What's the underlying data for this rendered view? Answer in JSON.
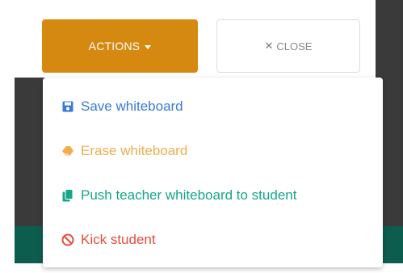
{
  "toolbar": {
    "actions_label": "ACTIONS",
    "close_label": "CLOSE"
  },
  "menu": {
    "items": [
      {
        "label": "Save whiteboard",
        "icon": "save-icon",
        "color": "#3a7bd5"
      },
      {
        "label": "Erase whiteboard",
        "icon": "eraser-icon",
        "color": "#f0ad4e"
      },
      {
        "label": "Push teacher whiteboard to student",
        "icon": "copy-icon",
        "color": "#17a589"
      },
      {
        "label": "Kick student",
        "icon": "ban-icon",
        "color": "#e74c3c"
      }
    ]
  },
  "colors": {
    "actions_button": "#d68910",
    "footer_bar": "#0d5d4e"
  }
}
